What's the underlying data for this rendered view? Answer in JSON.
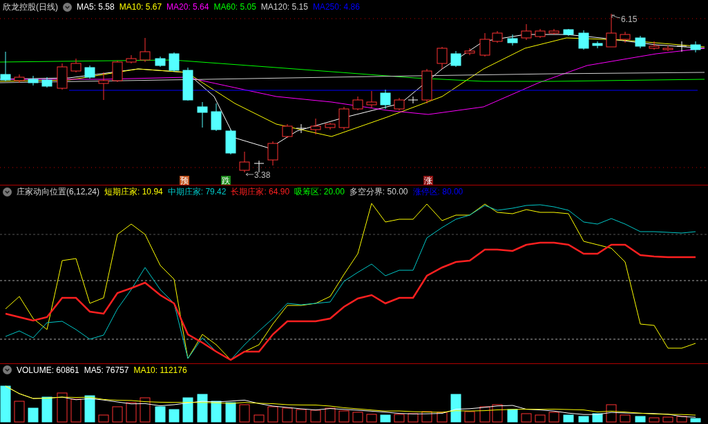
{
  "main_chart": {
    "title": "欣龙控股(日线)",
    "indicators": [
      {
        "label": "MA5: 5.58",
        "color": "#ffffff"
      },
      {
        "label": "MA10: 5.67",
        "color": "#ffff00"
      },
      {
        "label": "MA20: 5.64",
        "color": "#ff00ff"
      },
      {
        "label": "MA60: 5.05",
        "color": "#00ff00"
      },
      {
        "label": "MA120: 5.15",
        "color": "#d0d0d0"
      },
      {
        "label": "MA250: 4.86",
        "color": "#0000ff"
      }
    ],
    "high_label": "6.15",
    "low_label": "3.38",
    "signals": [
      {
        "text": "预",
        "color": "#c0501a"
      },
      {
        "text": "跌",
        "color": "#1a8a1a"
      },
      {
        "text": "涨",
        "color": "#8b1010"
      }
    ]
  },
  "indicator_panel": {
    "title": "庄家动向位置(6,12,24)",
    "values": [
      {
        "label": "短期庄家: 10.94",
        "color": "#ffff00"
      },
      {
        "label": "中期庄家: 79.42",
        "color": "#00c8c8"
      },
      {
        "label": "长期庄家: 64.90",
        "color": "#ff2020"
      },
      {
        "label": "吸筹区: 20.00",
        "color": "#00ff00"
      },
      {
        "label": "多空分界: 50.00",
        "color": "#d0d0d0"
      },
      {
        "label": "涨停区: 80.00",
        "color": "#0000ff"
      }
    ]
  },
  "volume_panel": {
    "values": [
      {
        "label": "VOLUME: 60861",
        "color": "#ffffff"
      },
      {
        "label": "MA5: 76757",
        "color": "#ffffff"
      },
      {
        "label": "MA10: 112176",
        "color": "#ffff00"
      }
    ]
  }
}
